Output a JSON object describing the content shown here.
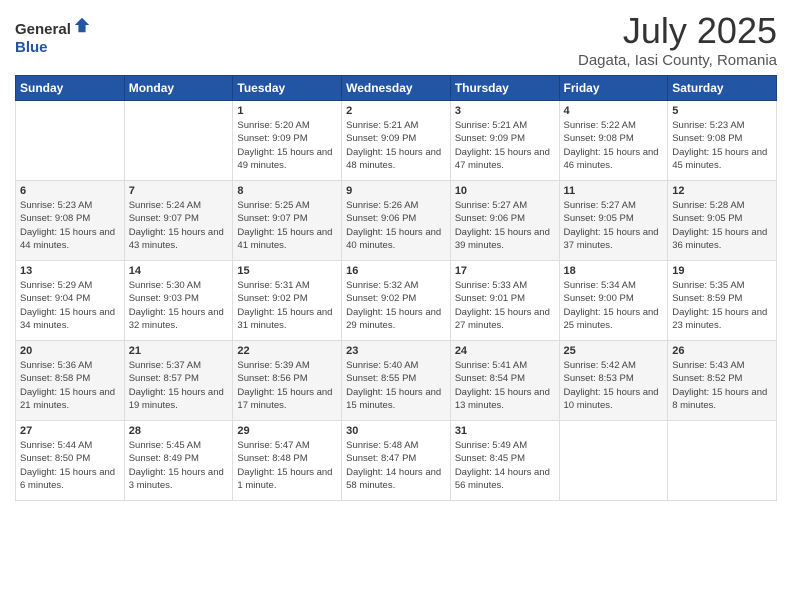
{
  "logo": {
    "text1": "General",
    "text2": "Blue"
  },
  "title": "July 2025",
  "location": "Dagata, Iasi County, Romania",
  "weekdays": [
    "Sunday",
    "Monday",
    "Tuesday",
    "Wednesday",
    "Thursday",
    "Friday",
    "Saturday"
  ],
  "weeks": [
    [
      {
        "day": "",
        "detail": ""
      },
      {
        "day": "",
        "detail": ""
      },
      {
        "day": "1",
        "detail": "Sunrise: 5:20 AM\nSunset: 9:09 PM\nDaylight: 15 hours and 49 minutes."
      },
      {
        "day": "2",
        "detail": "Sunrise: 5:21 AM\nSunset: 9:09 PM\nDaylight: 15 hours and 48 minutes."
      },
      {
        "day": "3",
        "detail": "Sunrise: 5:21 AM\nSunset: 9:09 PM\nDaylight: 15 hours and 47 minutes."
      },
      {
        "day": "4",
        "detail": "Sunrise: 5:22 AM\nSunset: 9:08 PM\nDaylight: 15 hours and 46 minutes."
      },
      {
        "day": "5",
        "detail": "Sunrise: 5:23 AM\nSunset: 9:08 PM\nDaylight: 15 hours and 45 minutes."
      }
    ],
    [
      {
        "day": "6",
        "detail": "Sunrise: 5:23 AM\nSunset: 9:08 PM\nDaylight: 15 hours and 44 minutes."
      },
      {
        "day": "7",
        "detail": "Sunrise: 5:24 AM\nSunset: 9:07 PM\nDaylight: 15 hours and 43 minutes."
      },
      {
        "day": "8",
        "detail": "Sunrise: 5:25 AM\nSunset: 9:07 PM\nDaylight: 15 hours and 41 minutes."
      },
      {
        "day": "9",
        "detail": "Sunrise: 5:26 AM\nSunset: 9:06 PM\nDaylight: 15 hours and 40 minutes."
      },
      {
        "day": "10",
        "detail": "Sunrise: 5:27 AM\nSunset: 9:06 PM\nDaylight: 15 hours and 39 minutes."
      },
      {
        "day": "11",
        "detail": "Sunrise: 5:27 AM\nSunset: 9:05 PM\nDaylight: 15 hours and 37 minutes."
      },
      {
        "day": "12",
        "detail": "Sunrise: 5:28 AM\nSunset: 9:05 PM\nDaylight: 15 hours and 36 minutes."
      }
    ],
    [
      {
        "day": "13",
        "detail": "Sunrise: 5:29 AM\nSunset: 9:04 PM\nDaylight: 15 hours and 34 minutes."
      },
      {
        "day": "14",
        "detail": "Sunrise: 5:30 AM\nSunset: 9:03 PM\nDaylight: 15 hours and 32 minutes."
      },
      {
        "day": "15",
        "detail": "Sunrise: 5:31 AM\nSunset: 9:02 PM\nDaylight: 15 hours and 31 minutes."
      },
      {
        "day": "16",
        "detail": "Sunrise: 5:32 AM\nSunset: 9:02 PM\nDaylight: 15 hours and 29 minutes."
      },
      {
        "day": "17",
        "detail": "Sunrise: 5:33 AM\nSunset: 9:01 PM\nDaylight: 15 hours and 27 minutes."
      },
      {
        "day": "18",
        "detail": "Sunrise: 5:34 AM\nSunset: 9:00 PM\nDaylight: 15 hours and 25 minutes."
      },
      {
        "day": "19",
        "detail": "Sunrise: 5:35 AM\nSunset: 8:59 PM\nDaylight: 15 hours and 23 minutes."
      }
    ],
    [
      {
        "day": "20",
        "detail": "Sunrise: 5:36 AM\nSunset: 8:58 PM\nDaylight: 15 hours and 21 minutes."
      },
      {
        "day": "21",
        "detail": "Sunrise: 5:37 AM\nSunset: 8:57 PM\nDaylight: 15 hours and 19 minutes."
      },
      {
        "day": "22",
        "detail": "Sunrise: 5:39 AM\nSunset: 8:56 PM\nDaylight: 15 hours and 17 minutes."
      },
      {
        "day": "23",
        "detail": "Sunrise: 5:40 AM\nSunset: 8:55 PM\nDaylight: 15 hours and 15 minutes."
      },
      {
        "day": "24",
        "detail": "Sunrise: 5:41 AM\nSunset: 8:54 PM\nDaylight: 15 hours and 13 minutes."
      },
      {
        "day": "25",
        "detail": "Sunrise: 5:42 AM\nSunset: 8:53 PM\nDaylight: 15 hours and 10 minutes."
      },
      {
        "day": "26",
        "detail": "Sunrise: 5:43 AM\nSunset: 8:52 PM\nDaylight: 15 hours and 8 minutes."
      }
    ],
    [
      {
        "day": "27",
        "detail": "Sunrise: 5:44 AM\nSunset: 8:50 PM\nDaylight: 15 hours and 6 minutes."
      },
      {
        "day": "28",
        "detail": "Sunrise: 5:45 AM\nSunset: 8:49 PM\nDaylight: 15 hours and 3 minutes."
      },
      {
        "day": "29",
        "detail": "Sunrise: 5:47 AM\nSunset: 8:48 PM\nDaylight: 15 hours and 1 minute."
      },
      {
        "day": "30",
        "detail": "Sunrise: 5:48 AM\nSunset: 8:47 PM\nDaylight: 14 hours and 58 minutes."
      },
      {
        "day": "31",
        "detail": "Sunrise: 5:49 AM\nSunset: 8:45 PM\nDaylight: 14 hours and 56 minutes."
      },
      {
        "day": "",
        "detail": ""
      },
      {
        "day": "",
        "detail": ""
      }
    ]
  ]
}
